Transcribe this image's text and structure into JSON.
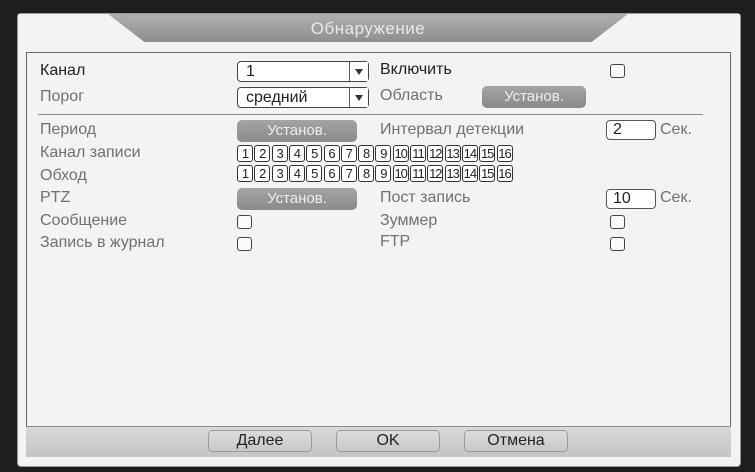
{
  "window": {
    "title": "Обнаружение"
  },
  "channel": {
    "label": "Канал",
    "value": "1"
  },
  "enable": {
    "label": "Включить"
  },
  "threshold": {
    "label": "Порог",
    "value": "средний"
  },
  "area": {
    "label": "Область",
    "button": "Установ."
  },
  "period": {
    "label": "Период",
    "button": "Установ."
  },
  "detect_interval": {
    "label": "Интервал детекции",
    "value": "2",
    "unit": "Сек."
  },
  "record_channel": {
    "label": "Канал записи",
    "boxes": [
      "1",
      "2",
      "3",
      "4",
      "5",
      "6",
      "7",
      "8",
      "9",
      "10",
      "11",
      "12",
      "13",
      "14",
      "15",
      "16"
    ]
  },
  "tour": {
    "label": "Обход",
    "boxes": [
      "1",
      "2",
      "3",
      "4",
      "5",
      "6",
      "7",
      "8",
      "9",
      "10",
      "11",
      "12",
      "13",
      "14",
      "15",
      "16"
    ]
  },
  "ptz": {
    "label": "PTZ",
    "button": "Установ."
  },
  "post_record": {
    "label": "Пост запись",
    "value": "10",
    "unit": "Сек."
  },
  "message": {
    "label": "Сообщение"
  },
  "buzzer": {
    "label": "Зуммер"
  },
  "log": {
    "label": "Запись в журнал"
  },
  "ftp": {
    "label": "FTP"
  },
  "footer": {
    "next": "Далее",
    "ok": "OK",
    "cancel": "Отмена"
  },
  "colors": {
    "panel_bg": "#f3f3f3",
    "title_bar": "#9e9e9e",
    "disabled_button": "#969696"
  }
}
